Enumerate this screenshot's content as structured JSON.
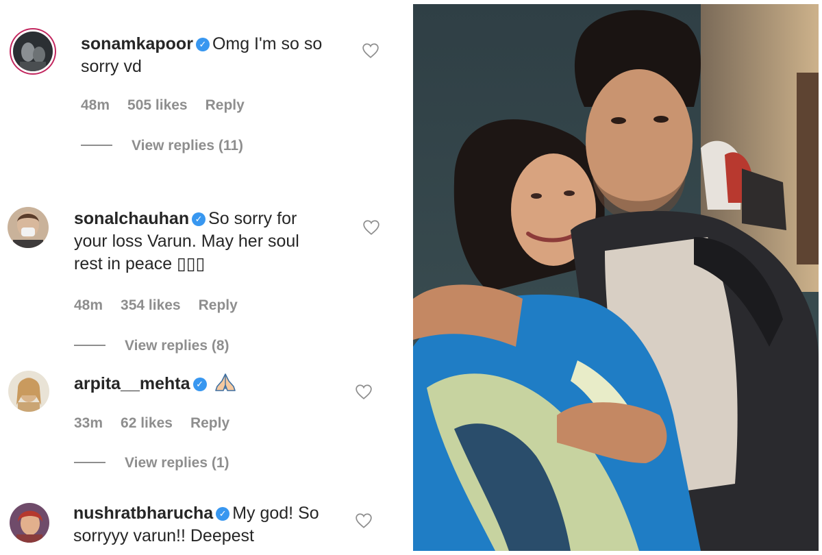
{
  "comments": [
    {
      "username": "sonamkapoor",
      "text_lines": [
        "Omg I'm so so",
        "sorry vd"
      ],
      "time": "48m",
      "likes": "505 likes",
      "reply": "Reply",
      "view_replies": "View replies (11)",
      "verified": true
    },
    {
      "username": "sonalchauhan",
      "text_lines": [
        "So sorry for",
        "your loss Varun. May her soul",
        "rest in peace ▯▯▯"
      ],
      "time": "48m",
      "likes": "354 likes",
      "reply": "Reply",
      "view_replies": "View replies (8)",
      "verified": true
    },
    {
      "username": "arpita__mehta",
      "text_lines": [
        ""
      ],
      "emoji": "folded-hands-icon",
      "time": "33m",
      "likes": "62 likes",
      "reply": "Reply",
      "view_replies": "View replies (1)",
      "verified": true
    },
    {
      "username": "nushratbharucha",
      "text_lines": [
        "My god! So",
        "sorryyy varun!! Deepest"
      ],
      "verified": true
    }
  ],
  "icons": {
    "verified": "verified-badge-icon",
    "like": "heart-outline-icon"
  },
  "colors": {
    "verified_blue": "#3897f0",
    "meta_gray": "#8e8e8e",
    "story_ring": "#c2265e",
    "text": "#262626"
  }
}
